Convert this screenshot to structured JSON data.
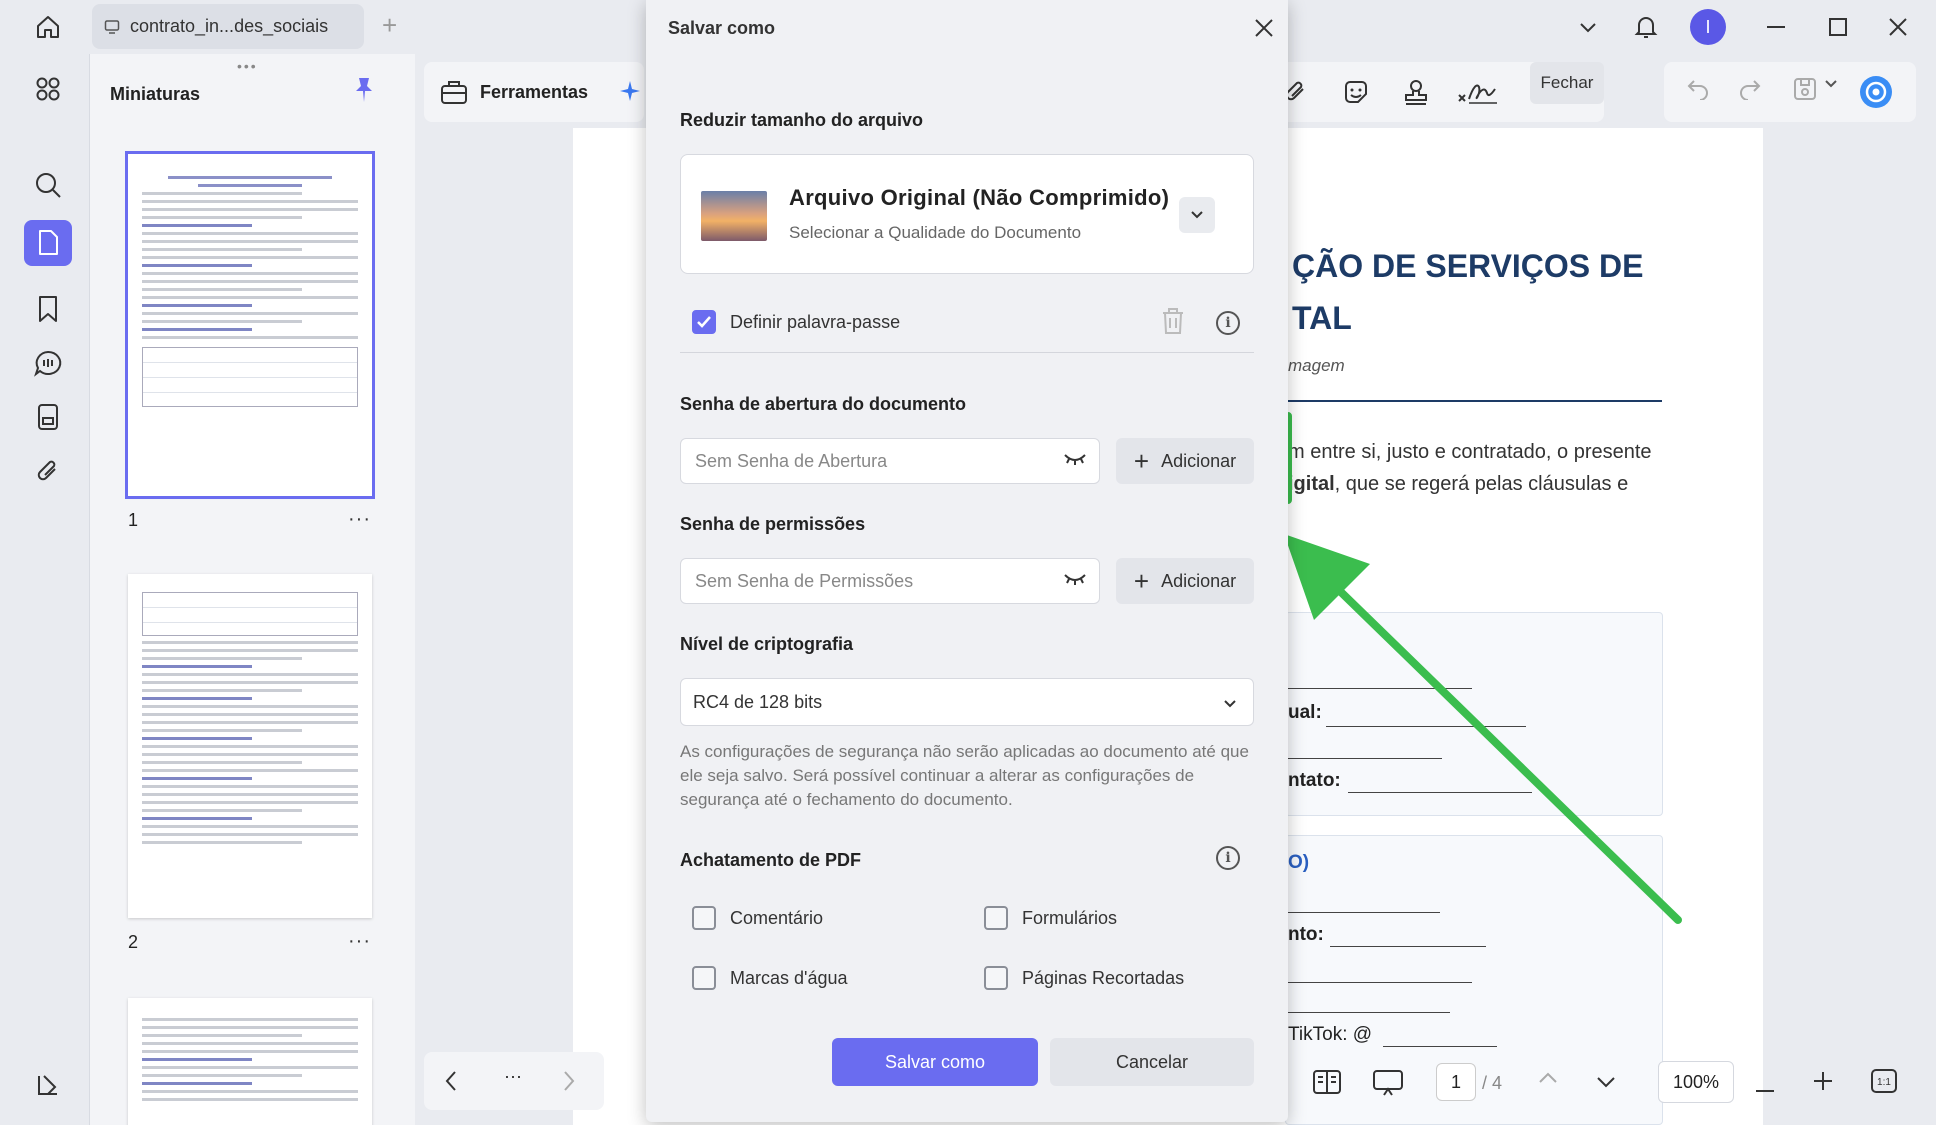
{
  "titlebar": {
    "tab_label": "contrato_in...des_sociais",
    "new_tab": "+",
    "avatar_initial": "I"
  },
  "thumbnails": {
    "title": "Miniaturas",
    "pages": [
      {
        "number": "1"
      },
      {
        "number": "2"
      }
    ],
    "more": "···"
  },
  "toolbar": {
    "tools_label": "Ferramentas",
    "close_label": "Fechar"
  },
  "document": {
    "heading_line1": "ÇÃO DE SERVIÇOS DE",
    "heading_line2": "TAL",
    "subtitle": "magem",
    "para_line1": "m entre si, justo e contratado, o presente",
    "para_line2_bold": "igital",
    "para_line2_rest": ", que se regerá pelas cláusulas e",
    "box1": {
      "l1": "ual:",
      "l2": "ntato:"
    },
    "box2": {
      "l0": "O)",
      "l1": "nto:",
      "l2": "TikTok: @"
    }
  },
  "bottombar": {
    "current_page": "1",
    "total_pages": "/ 4",
    "zoom": "100%"
  },
  "dialog": {
    "title": "Salvar como",
    "reduce_title": "Reduzir tamanho do arquivo",
    "quality_title": "Arquivo Original (Não Comprimido)",
    "quality_sub": "Selecionar a Qualidade do Documento",
    "set_password_label": "Definir palavra-passe",
    "set_password_checked": true,
    "open_password_title": "Senha de abertura do documento",
    "open_password_placeholder": "Sem Senha de Abertura",
    "add_label": "Adicionar",
    "permissions_title": "Senha de permissões",
    "permissions_placeholder": "Sem Senha de Permissões",
    "encryption_title": "Nível de criptografia",
    "encryption_value": "RC4 de 128 bits",
    "note": "As configurações de segurança não serão aplicadas ao documento até que ele seja salvo. Será possível continuar a alterar as configurações de segurança até o fechamento do documento.",
    "flatten_title": "Achatamento de PDF",
    "flatten_options": [
      {
        "label": "Comentário",
        "checked": false
      },
      {
        "label": "Formulários",
        "checked": false
      },
      {
        "label": "Marcas d'água",
        "checked": false
      },
      {
        "label": "Páginas Recortadas",
        "checked": false
      }
    ],
    "save_label": "Salvar como",
    "cancel_label": "Cancelar"
  },
  "colors": {
    "accent": "#6a6cf0",
    "highlight": "#3bbd4e",
    "doc_heading": "#1d3b66"
  }
}
